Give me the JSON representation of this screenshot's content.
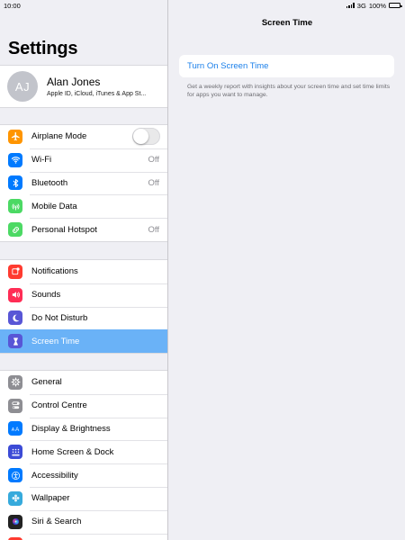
{
  "status_bar": {
    "time": "10:00",
    "network": "3G",
    "battery": "100%"
  },
  "sidebar": {
    "title": "Settings",
    "profile": {
      "initials": "AJ",
      "name": "Alan Jones",
      "subtitle": "Apple ID, iCloud, iTunes & App St..."
    },
    "groups": [
      [
        {
          "label": "Airplane Mode",
          "icon": "airplane-icon",
          "color": "#ff9500",
          "control": "toggle",
          "on": false
        },
        {
          "label": "Wi-Fi",
          "icon": "wifi-icon",
          "color": "#007aff",
          "value": "Off"
        },
        {
          "label": "Bluetooth",
          "icon": "bluetooth-icon",
          "color": "#007aff",
          "value": "Off"
        },
        {
          "label": "Mobile Data",
          "icon": "antenna-icon",
          "color": "#4cd964"
        },
        {
          "label": "Personal Hotspot",
          "icon": "hotspot-icon",
          "color": "#4cd964",
          "value": "Off"
        }
      ],
      [
        {
          "label": "Notifications",
          "icon": "notifications-icon",
          "color": "#ff3b30"
        },
        {
          "label": "Sounds",
          "icon": "speaker-icon",
          "color": "#ff2d55"
        },
        {
          "label": "Do Not Disturb",
          "icon": "moon-icon",
          "color": "#5856d6"
        },
        {
          "label": "Screen Time",
          "icon": "hourglass-icon",
          "color": "#5856d6",
          "selected": true
        }
      ],
      [
        {
          "label": "General",
          "icon": "gear-icon",
          "color": "#8e8e93"
        },
        {
          "label": "Control Centre",
          "icon": "switches-icon",
          "color": "#8e8e93"
        },
        {
          "label": "Display & Brightness",
          "icon": "text-size-icon",
          "color": "#007aff"
        },
        {
          "label": "Home Screen & Dock",
          "icon": "grid-icon",
          "color": "#3c4bd6"
        },
        {
          "label": "Accessibility",
          "icon": "accessibility-icon",
          "color": "#007aff"
        },
        {
          "label": "Wallpaper",
          "icon": "flower-icon",
          "color": "#36aadc"
        },
        {
          "label": "Siri & Search",
          "icon": "siri-icon",
          "color": "#222222"
        }
      ]
    ]
  },
  "detail": {
    "title": "Screen Time",
    "action_label": "Turn On Screen Time",
    "footer": "Get a weekly report with insights about your screen time and set time limits for apps you want to manage."
  },
  "colors": {
    "accent": "#1a7fea",
    "selected_row": "#6ab2f7"
  }
}
